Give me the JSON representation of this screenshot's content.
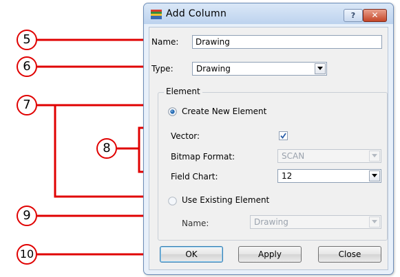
{
  "dialog": {
    "title": "Add Column",
    "help_symbol": "?",
    "close_symbol": "✕"
  },
  "fields": {
    "name_label": "Name:",
    "name_value": "Drawing",
    "type_label": "Type:",
    "type_value": "Drawing"
  },
  "element_group": {
    "title": "Element",
    "create_new_label": "Create New Element",
    "create_new_selected": true,
    "vector_label": "Vector:",
    "vector_checked": true,
    "bitmap_format_label": "Bitmap Format:",
    "bitmap_format_value": "SCAN",
    "field_chart_label": "Field Chart:",
    "field_chart_value": "12",
    "use_existing_label": "Use Existing Element",
    "use_existing_selected": false,
    "existing_name_label": "Name:",
    "existing_name_value": "Drawing"
  },
  "buttons": {
    "ok": "OK",
    "apply": "Apply",
    "close": "Close"
  },
  "callouts": [
    "5",
    "6",
    "7",
    "8",
    "9",
    "10"
  ],
  "colors": {
    "callout": "#e00000",
    "radio_selected": "#2b6fb5",
    "check": "#2a5da8"
  }
}
